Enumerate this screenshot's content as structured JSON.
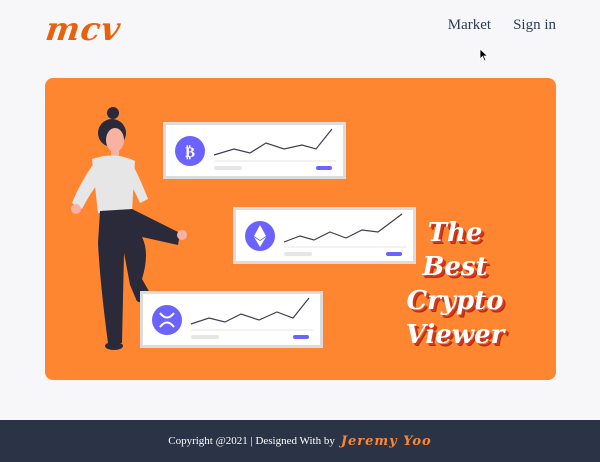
{
  "header": {
    "logo": "mcv",
    "nav": {
      "market": "Market",
      "signin": "Sign in"
    }
  },
  "hero": {
    "tagline_lines": [
      "The",
      "Best",
      "Crypto",
      "Viewer"
    ],
    "cards": [
      {
        "coin": "Bitcoin",
        "icon": "bitcoin-icon",
        "symbol": "₿"
      },
      {
        "coin": "Ethereum",
        "icon": "ethereum-icon",
        "symbol": "◆"
      },
      {
        "coin": "Ripple",
        "icon": "ripple-icon",
        "symbol": "✕"
      }
    ],
    "accent": "#ff8631",
    "coin_color": "#6c63ff"
  },
  "footer": {
    "text": "Copyright @2021 | Designed With by",
    "author": "Jeremy Yoo"
  }
}
